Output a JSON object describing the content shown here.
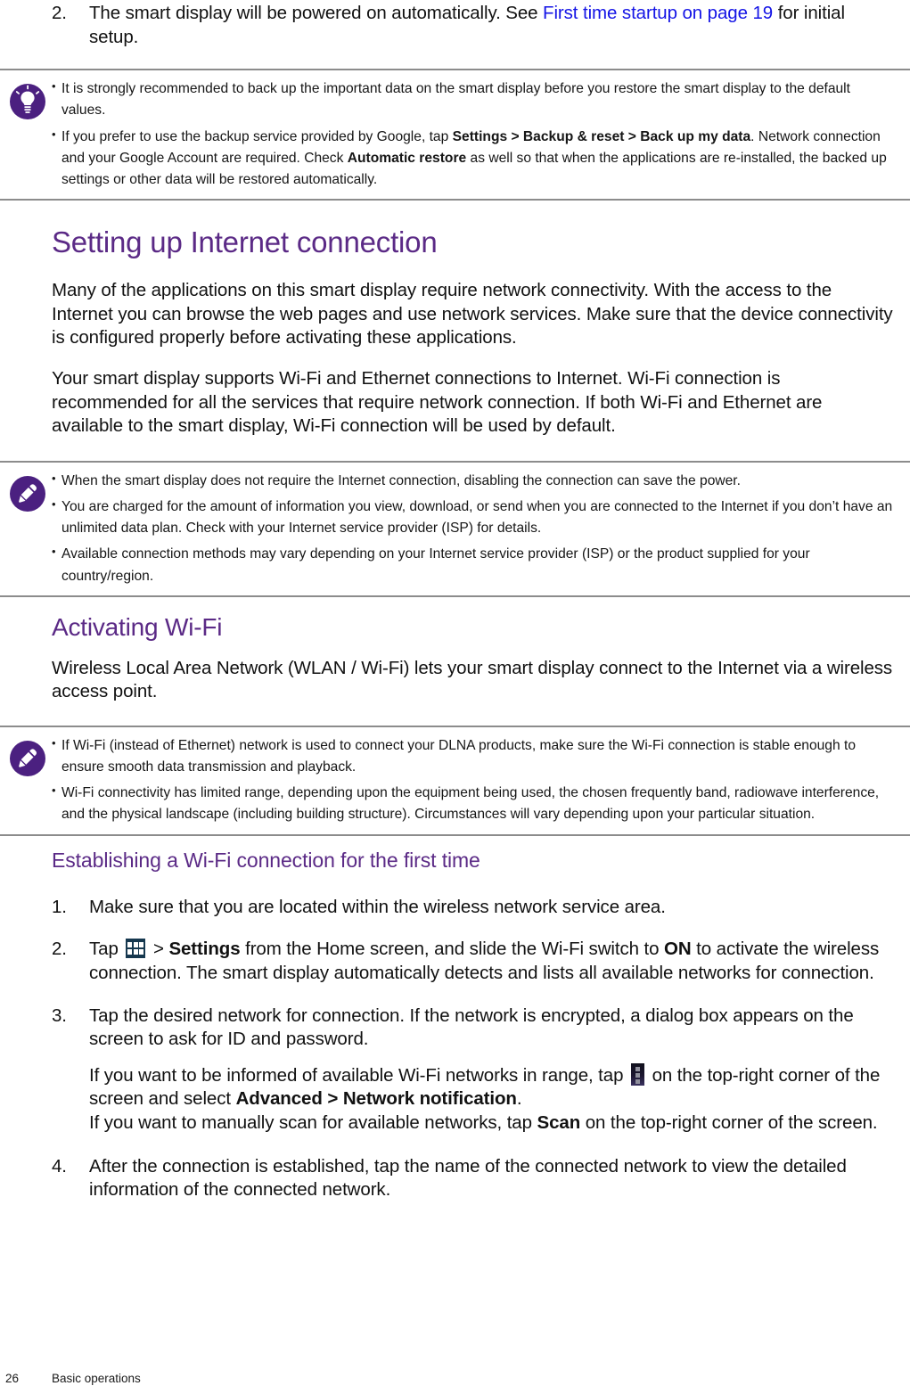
{
  "top_step": {
    "number": "2.",
    "text_before": "The smart display will be powered on automatically. See ",
    "link": "First time startup on page 19",
    "text_after": " for initial setup."
  },
  "tip_note": {
    "icon": "lightbulb-icon",
    "items": [
      {
        "segments": [
          {
            "type": "plain",
            "text": "It is strongly recommended to back up the important data on the smart display before you restore the smart display to the default values."
          }
        ]
      },
      {
        "segments": [
          {
            "type": "plain",
            "text": "If you prefer to use the backup service provided by Google, tap "
          },
          {
            "type": "bold",
            "text": "Settings > Backup & reset > Back up my data"
          },
          {
            "type": "plain",
            "text": ". Network connection and your Google Account are required. Check "
          },
          {
            "type": "bold",
            "text": "Automatic restore"
          },
          {
            "type": "plain",
            "text": " as well so that when the applications are re-installed, the backed up settings or other data will be restored automatically."
          }
        ]
      }
    ]
  },
  "section_internet": {
    "heading": "Setting up Internet connection",
    "paragraphs": [
      "Many of the applications on this smart display require network connectivity. With the access to the Internet you can browse the web pages and use network services. Make sure that the device connectivity is configured properly before activating these applications.",
      "Your smart display supports Wi-Fi and Ethernet connections to Internet. Wi-Fi connection is recommended for all the services that require network connection. If both Wi-Fi and Ethernet are available to the smart display, Wi-Fi connection will be used by default."
    ]
  },
  "note_internet": {
    "icon": "pencil-icon",
    "items": [
      "When the smart display does not require the Internet connection, disabling the connection can save the power.",
      "You are charged for the amount of information you view, download, or send when you are connected to the Internet if you don’t have an unlimited data plan. Check with your Internet service provider (ISP) for details.",
      "Available connection methods may vary depending on your Internet service provider (ISP) or the product supplied for your country/region."
    ]
  },
  "section_wifi": {
    "heading": "Activating Wi-Fi",
    "paragraph": "Wireless Local Area Network (WLAN / Wi-Fi) lets your smart display connect to the Internet via a wireless access point."
  },
  "note_wifi": {
    "icon": "pencil-icon",
    "items": [
      "If Wi-Fi (instead of Ethernet) network is used to connect your DLNA products, make sure the Wi-Fi connection is stable enough to ensure smooth data transmission and playback.",
      "Wi-Fi connectivity has limited range, depending upon the equipment being used, the chosen frequently band, radiowave interference, and the physical landscape (including building structure). Circumstances will vary depending upon your particular situation."
    ]
  },
  "section_establish": {
    "heading": "Establishing a Wi-Fi connection for the first time",
    "steps": [
      {
        "number": "1.",
        "text": "Make sure that you are located within the wireless network service area."
      },
      {
        "number": "2.",
        "before_icon": "Tap ",
        "icon": "app-drawer-icon",
        "after_icon_plain_1": " > ",
        "after_icon_bold_1": "Settings",
        "after_icon_plain_2": " from the Home screen, and slide the Wi-Fi switch to ",
        "after_icon_bold_2": "ON",
        "after_icon_plain_3": " to activate the wireless connection. The smart display automatically detects and lists all available networks for connection."
      },
      {
        "number": "3.",
        "main": "Tap the desired network for connection. If the network is encrypted, a dialog box appears on the screen to ask for ID and password.",
        "sub_before_icon": "If you want to be informed of available Wi-Fi networks in range, tap ",
        "icon": "overflow-menu-icon",
        "sub_after_icon": " on the top-right corner of the screen and select ",
        "sub_bold_1": "Advanced > Network notification",
        "sub_after_bold": ".",
        "sub_line2_before": "If you want to manually scan for available networks, tap ",
        "sub_line2_bold": "Scan",
        "sub_line2_after": " on the top-right corner of the screen."
      },
      {
        "number": "4.",
        "text": "After the connection is established, tap the name of the connected network to view the detailed information of the connected network."
      }
    ]
  },
  "footer": {
    "page_number": "26",
    "chapter": "Basic operations"
  },
  "colors": {
    "heading_purple": "#5b2a86",
    "link_blue": "#1414e6",
    "icon_purple": "#4b2080",
    "rule_gray": "#8c8c8c",
    "app_icon_navy": "#16384f"
  }
}
